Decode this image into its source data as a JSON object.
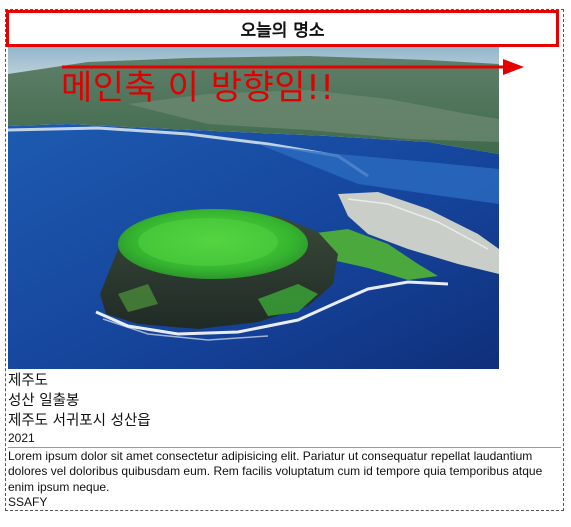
{
  "card": {
    "title": "오늘의 명소",
    "overlay_text": "메인축 이 방향임!!",
    "province": "제주도",
    "place_name": "성산 일출봉",
    "address": "제주도 서귀포시 성산읍",
    "year": "2021",
    "description": "Lorem ipsum dolor sit amet consectetur adipisicing elit. Pariatur ut consequatur repellat laudantium dolores vel doloribus quibusdam eum. Rem facilis voluptatum cum id tempore quia temporibus atque enim ipsum neque.",
    "author": "SSAFY"
  },
  "colors": {
    "annotation_red": "#e60000",
    "card_border": "#555555",
    "sea_blue": "#1a4fa8",
    "crater_green": "#3fc43a"
  }
}
